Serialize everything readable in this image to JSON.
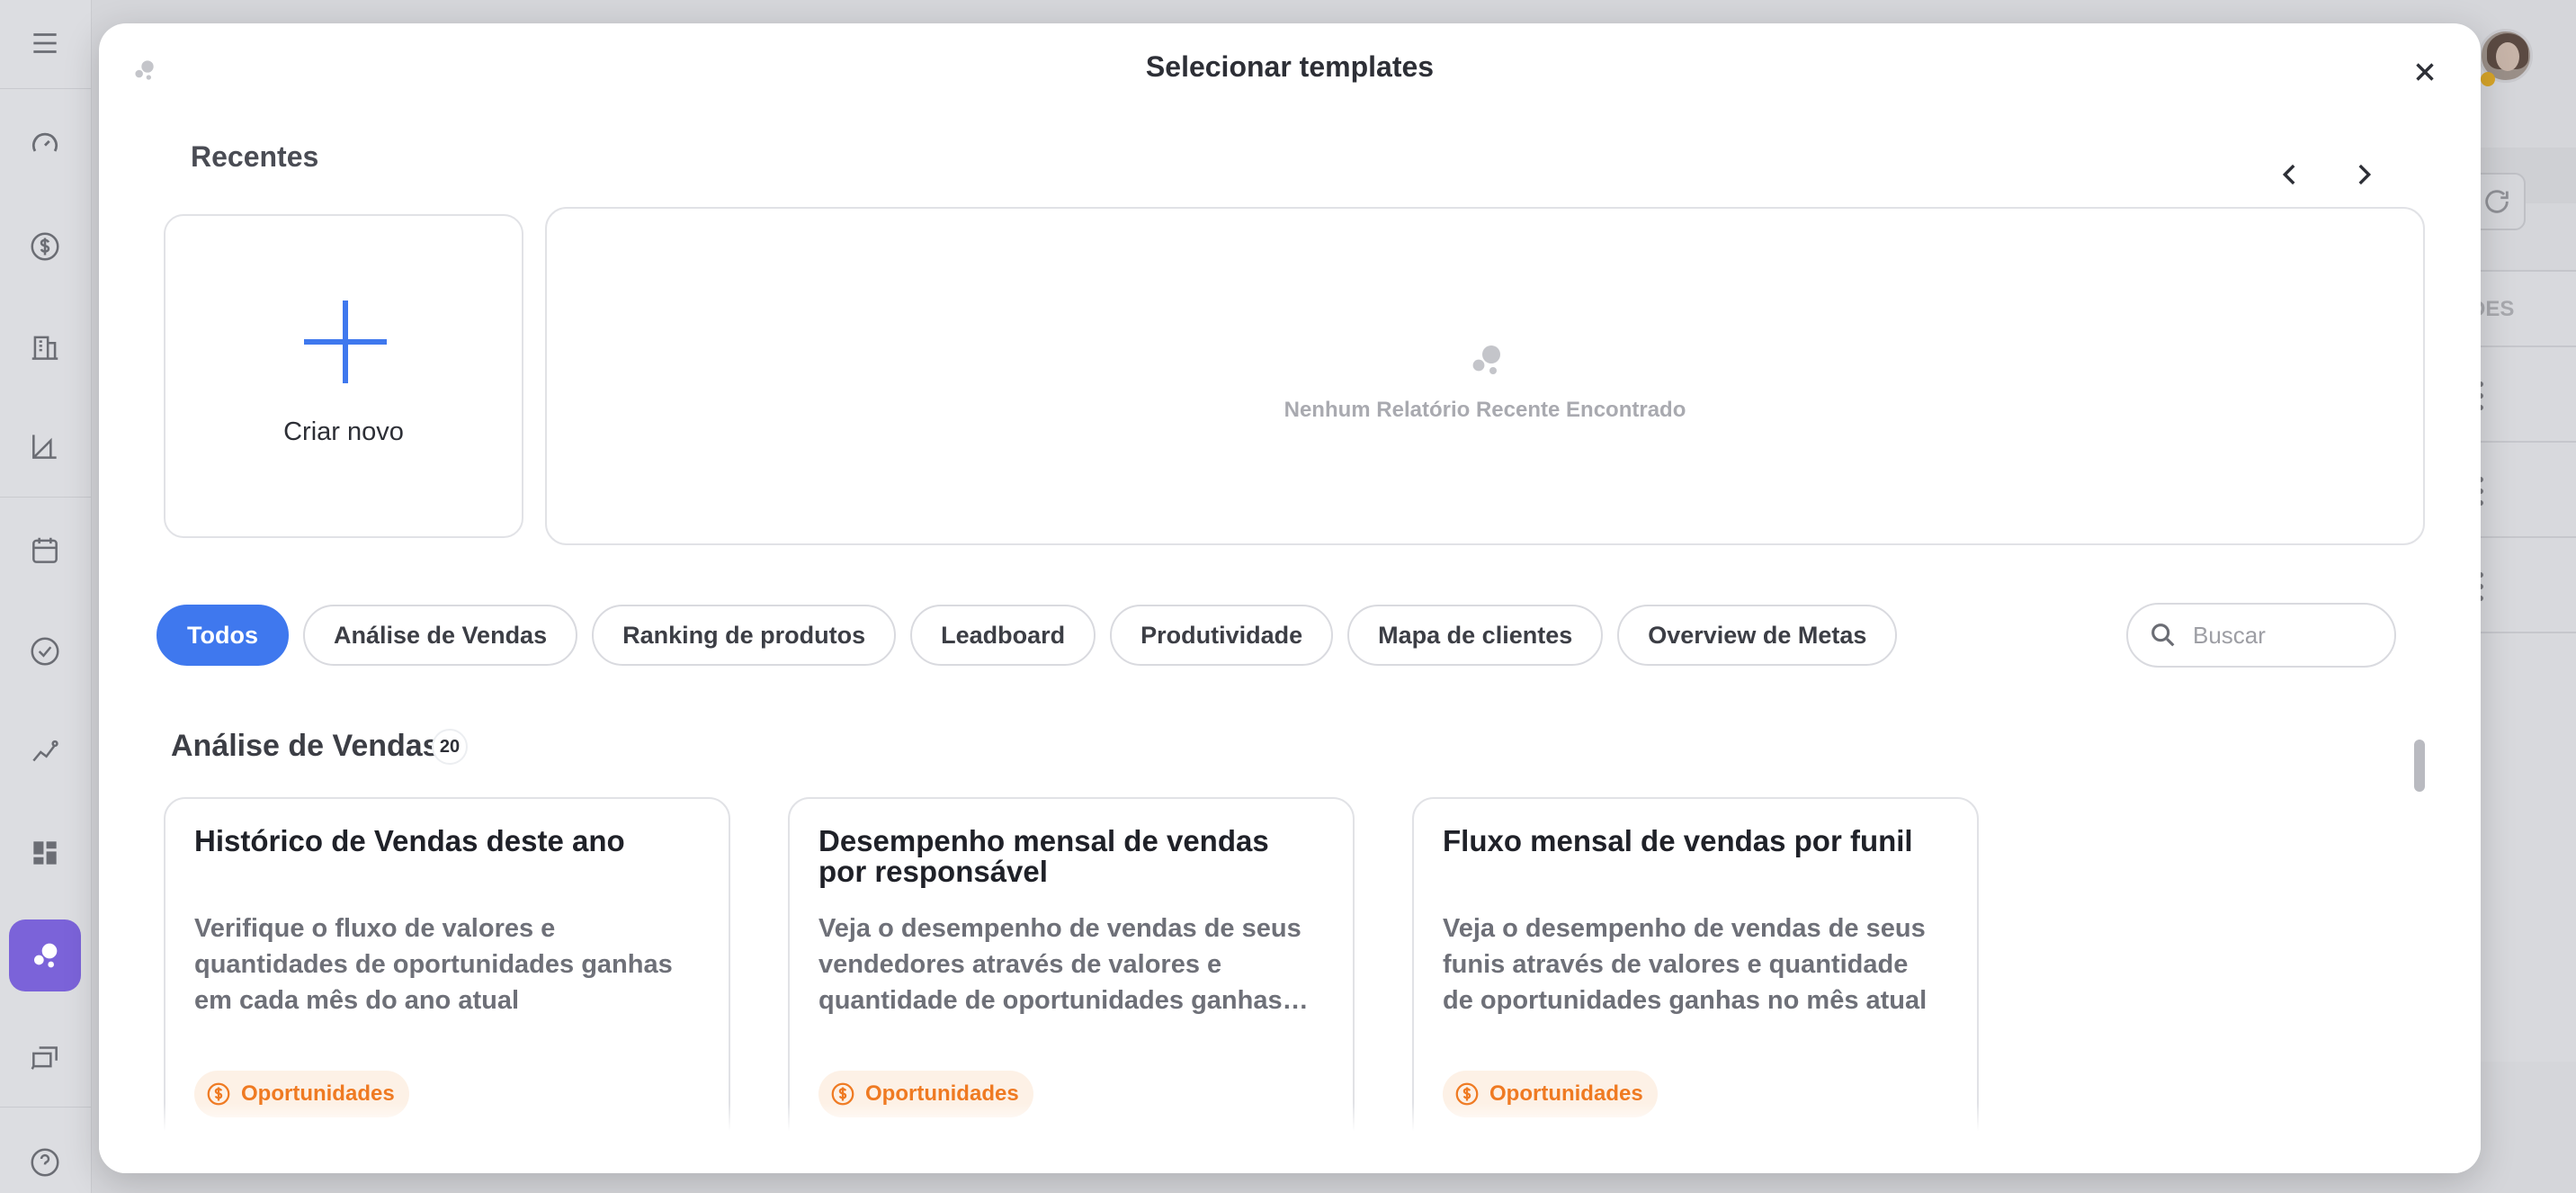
{
  "modal": {
    "title": "Selecionar templates",
    "recent_section_title": "Recentes",
    "create_new_label": "Criar novo",
    "no_recent_message": "Nenhum Relatório Recente Encontrado"
  },
  "filters": [
    {
      "label": "Todos",
      "active": true
    },
    {
      "label": "Análise de Vendas",
      "active": false
    },
    {
      "label": "Ranking de produtos",
      "active": false
    },
    {
      "label": "Leadboard",
      "active": false
    },
    {
      "label": "Produtividade",
      "active": false
    },
    {
      "label": "Mapa de clientes",
      "active": false
    },
    {
      "label": "Overview de Metas",
      "active": false
    }
  ],
  "search": {
    "placeholder": "Buscar"
  },
  "category": {
    "title": "Análise de Vendas",
    "count": "20",
    "templates": [
      {
        "title": "Histórico de Vendas deste ano",
        "description": "Verifique o fluxo de valores e quantidades de oportunidades ganhas em cada mês do ano atual",
        "tag": "Oportunidades"
      },
      {
        "title": "Desempenho mensal de vendas por responsável",
        "description": "Veja o desempenho de vendas de seus vendedores através de valores e quantidade de oportunidades ganhas no mês atual",
        "tag": "Oportunidades"
      },
      {
        "title": "Fluxo mensal de vendas por funil",
        "description": "Veja o desempenho de vendas de seus funis através de valores e quantidade de oportunidades ganhas no mês atual",
        "tag": "Oportunidades"
      }
    ]
  },
  "background": {
    "table_header_fragment": "DES"
  },
  "colors": {
    "accent": "#3f78ee",
    "active_nav": "#7b63d9",
    "tag_text": "#ef7a22",
    "tag_bg": "#fdf1e6"
  }
}
